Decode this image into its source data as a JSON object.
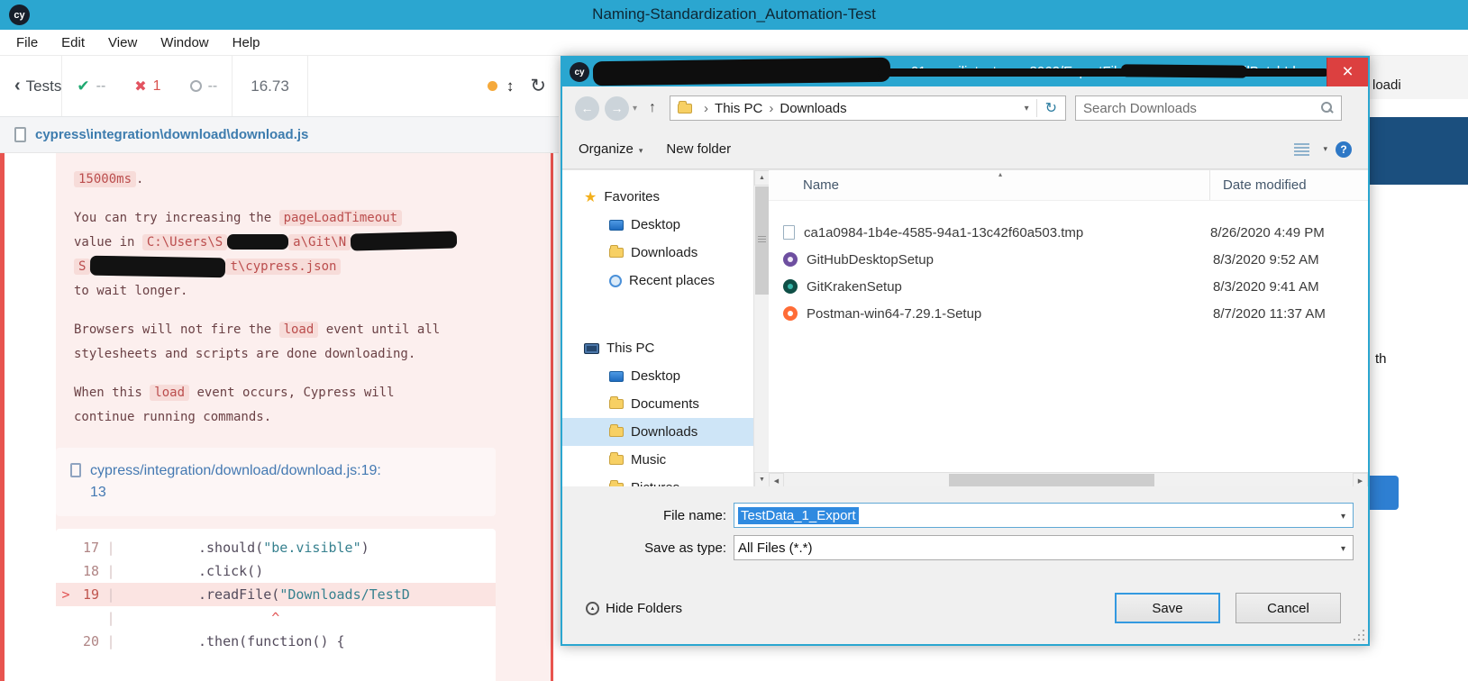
{
  "app": {
    "title": "Naming-Standardization_Automation-Test",
    "logo": "cy"
  },
  "menubar": {
    "items": [
      "File",
      "Edit",
      "View",
      "Window",
      "Help"
    ]
  },
  "icons": {
    "chevron_left": "‹",
    "check": "✔",
    "cross": "✖",
    "updown": "↕",
    "refresh": "↻",
    "back": "←",
    "forward": "→",
    "up": "↑",
    "dropdown": "▾",
    "crumb_sep": "›",
    "star": "★",
    "sort_asc": "▴",
    "sb_up": "▲",
    "sb_down": "▼",
    "sb_left": "◀",
    "sb_right": "▶",
    "help": "?",
    "hide_arrow": "▴",
    "close": "×",
    "pipe": "|"
  },
  "runner": {
    "tests_label": "Tests",
    "passed": "--",
    "failed": "1",
    "pending": "--",
    "duration": "16.73",
    "spec_path": "cypress\\integration\\download\\download.js",
    "error": {
      "code_timeout": "15000ms",
      "after_timeout": ".",
      "p1a": "You can try increasing the ",
      "p1code": "pageLoadTimeout",
      "p1b": "value in ",
      "path1": "C:\\Users\\S",
      "path2": "a\\Git\\N",
      "path3": "S",
      "path4": "t\\cypress.json",
      "p1c": "to wait longer.",
      "p2l1a": "Browsers will not fire the ",
      "p2code": "load",
      "p2l1b": " event until all",
      "p2l2": "stylesheets and scripts are done downloading.",
      "p3l1a": "When this ",
      "p3code": "load",
      "p3l1b": " event occurs, Cypress will",
      "p3l2": "continue running commands.",
      "link_line1": "cypress/integration/download/download.js:19:",
      "link_line2": "13"
    },
    "code": {
      "l17_no": "17",
      "l17_a": ".should(",
      "l17_s": "\"be.visible\"",
      "l17_c": ")",
      "l18_no": "18",
      "l18_a": ".click()",
      "l19_mark": ">",
      "l19_no": "19",
      "l19_a": ".readFile(",
      "l19_s": "\"Downloads/TestD",
      "caret": "         ^",
      "l20_no": "20",
      "l20_a": ".then(function() {"
    }
  },
  "dialog": {
    "title_open": "(",
    "title_visible": "rver01.consiliotest.com:8062/ExportFile/DownloadFile?emailBatchId",
    "title_ellipsis": "...",
    "nav": {
      "breadcrumb_root": "This PC",
      "breadcrumb_current": "Downloads",
      "search_text": "Search Downloads"
    },
    "cmdbar": {
      "organize": "Organize",
      "new_folder": "New folder"
    },
    "sidebar": {
      "favorites_label": "Favorites",
      "fav_items": [
        "Desktop",
        "Downloads",
        "Recent places"
      ],
      "thispc_label": "This PC",
      "pc_items": [
        "Desktop",
        "Documents",
        "Downloads",
        "Music",
        "Pictures"
      ]
    },
    "list": {
      "col_name": "Name",
      "col_date": "Date modified",
      "rows": [
        {
          "name": "ca1a0984-1b4e-4585-94a1-13c42f60a503.tmp",
          "date": "8/26/2020 4:49 PM"
        },
        {
          "name": "GitHubDesktopSetup",
          "date": "8/3/2020 9:52 AM"
        },
        {
          "name": "GitKrakenSetup",
          "date": "8/3/2020 9:41 AM"
        },
        {
          "name": "Postman-win64-7.29.1-Setup",
          "date": "8/7/2020 11:37 AM"
        }
      ]
    },
    "fields": {
      "file_name_label": "File name:",
      "file_name_value": "TestData_1_Export",
      "save_type_label": "Save as type:",
      "save_type_value": "All Files (*.*)"
    },
    "footer": {
      "hide_folders": "Hide Folders",
      "save": "Save",
      "cancel": "Cancel"
    }
  },
  "background": {
    "partial_text_top": "loadi",
    "partial_text_mid": "th"
  }
}
